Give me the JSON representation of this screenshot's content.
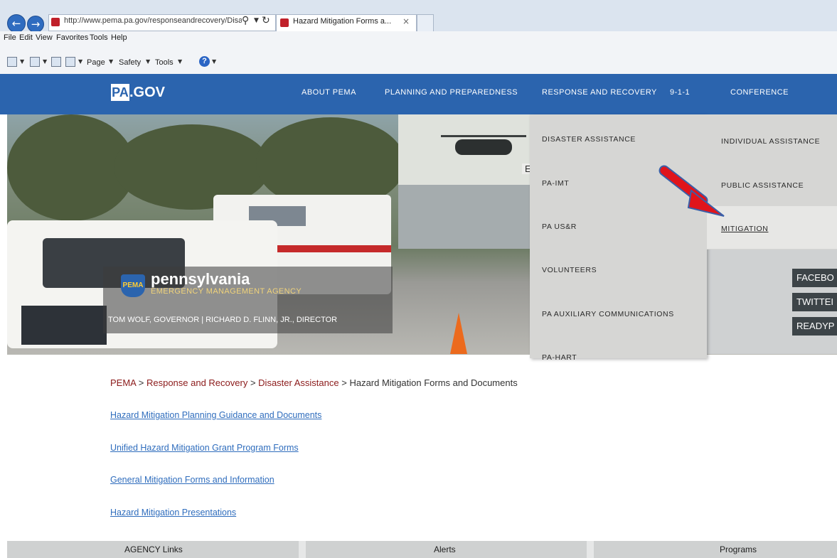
{
  "browser": {
    "url": "http://www.pema.pa.gov/responseandrecovery/Disaster-Assist",
    "tab_title": "Hazard Mitigation Forms a...",
    "menu": [
      "File",
      "Edit",
      "View",
      "Favorites",
      "Tools",
      "Help"
    ],
    "commands": {
      "page": "Page",
      "safety": "Safety",
      "tools": "Tools"
    },
    "icons": {
      "back": "back-arrow-icon",
      "forward": "forward-arrow-icon",
      "search": "search-icon",
      "refresh": "refresh-icon",
      "close": "close-icon",
      "help": "help-icon"
    }
  },
  "site": {
    "logo_pa": "PA",
    "logo_gov": ".GOV",
    "nav": {
      "about": "ABOUT PEMA",
      "planning": "PLANNING AND PREPAREDNESS",
      "response": "RESPONSE AND RECOVERY",
      "nine11": "9-1-1",
      "conference": "CONFERENCE"
    },
    "brand_color": "#2b64ae"
  },
  "hero": {
    "agency_badge": "PEMA",
    "agency_name": "pennsylvania",
    "agency_sub": "EMERGENCY MANAGEMENT AGENCY",
    "officials": "TOM WOLF, GOVERNOR  |  RICHARD D. FLINN, JR., DIRECTOR",
    "partial_label": "En",
    "social": [
      "FACEBO",
      "TWITTEI",
      "READYP"
    ]
  },
  "dropdown": {
    "column1": [
      "DISASTER ASSISTANCE",
      "PA-IMT",
      "PA US&R",
      "VOLUNTEERS",
      "PA AUXILIARY COMMUNICATIONS",
      "PA-HART"
    ],
    "column2": [
      "INDIVIDUAL ASSISTANCE",
      "PUBLIC ASSISTANCE",
      "MITIGATION"
    ],
    "highlight_arrow_color": "#e0141b"
  },
  "breadcrumb": {
    "items": [
      "PEMA",
      "Response and Recovery",
      "Disaster Assistance",
      "Hazard Mitigation Forms and Documents"
    ],
    "separator": ">"
  },
  "links": [
    "Hazard Mitigation Planning Guidance and Documents",
    "Unified Hazard Mitigation Grant Program Forms",
    "General Mitigation Forms and Information",
    "Hazard Mitigation Presentations"
  ],
  "footer": {
    "agency_links": "AGENCY Links",
    "alerts": "Alerts",
    "programs": "Programs"
  }
}
